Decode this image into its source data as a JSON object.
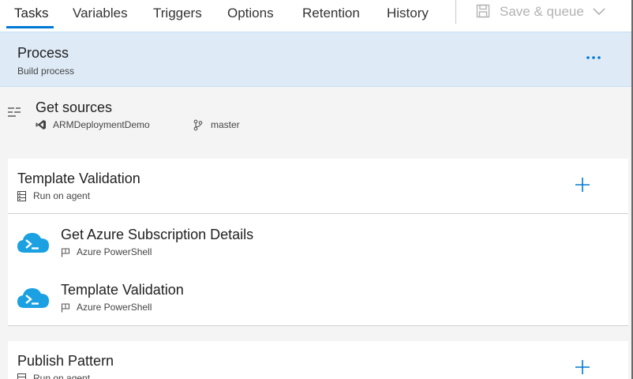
{
  "tabs": [
    {
      "label": "Tasks",
      "active": true
    },
    {
      "label": "Variables"
    },
    {
      "label": "Triggers"
    },
    {
      "label": "Options"
    },
    {
      "label": "Retention"
    },
    {
      "label": "History"
    }
  ],
  "toolbar": {
    "save_queue_label": "Save & queue",
    "save_icon": "save-icon",
    "dropdown_icon": "chevron-down-icon"
  },
  "process": {
    "title": "Process",
    "subtitle": "Build process",
    "more_icon": "more-icon"
  },
  "sources": {
    "title": "Get sources",
    "repository": "ARMDeploymentDemo",
    "branch": "master"
  },
  "phases": [
    {
      "title": "Template Validation",
      "subtitle": "Run on agent",
      "tasks": [
        {
          "title": "Get Azure Subscription Details",
          "subtitle": "Azure PowerShell"
        },
        {
          "title": "Template Validation",
          "subtitle": "Azure PowerShell"
        }
      ]
    },
    {
      "title": "Publish Pattern",
      "subtitle": "Run on agent",
      "tasks": []
    }
  ],
  "colors": {
    "accent": "#0078d4",
    "process_bg": "#deebf7",
    "azure_icon": "#1ba1e2"
  }
}
